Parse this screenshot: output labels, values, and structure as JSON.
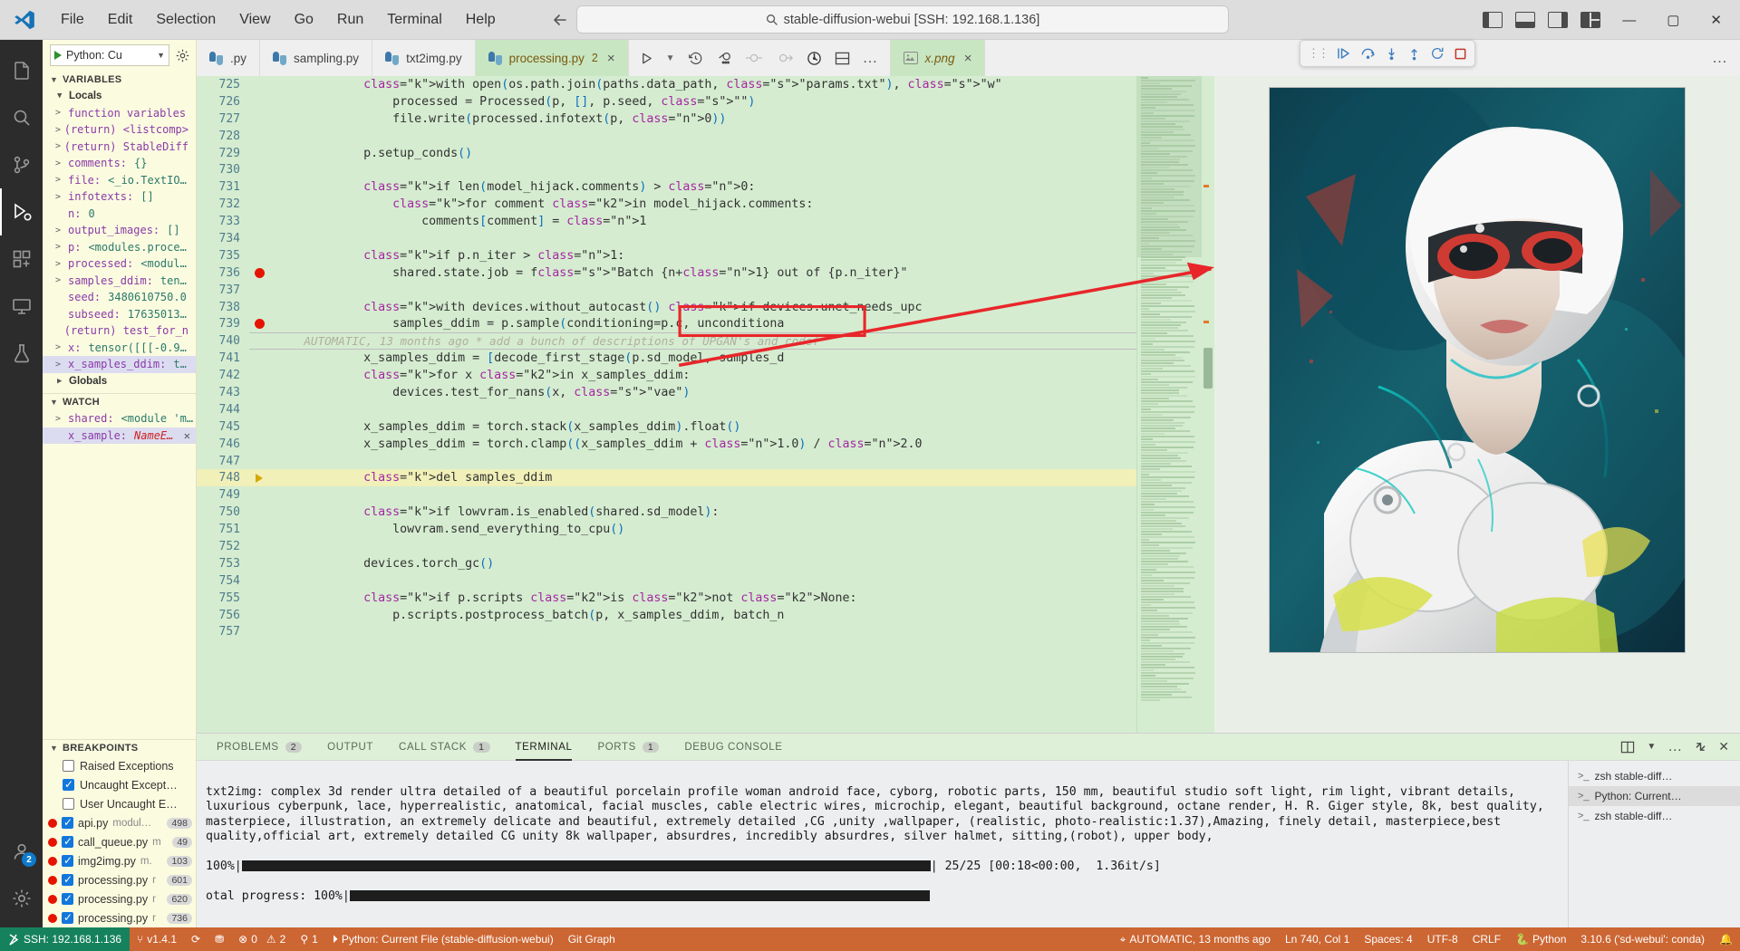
{
  "titlebar": {
    "menus": [
      "File",
      "Edit",
      "Selection",
      "View",
      "Go",
      "Run",
      "Terminal",
      "Help"
    ],
    "search_text": "stable-diffusion-webui [SSH: 192.168.1.136]",
    "search_icon": "search-icon",
    "back_icon": "arrow-left-icon",
    "forward_icon": "arrow-right-icon",
    "layout_icons": [
      "toggle-primary-sidebar-icon",
      "toggle-panel-icon",
      "toggle-secondary-sidebar-icon",
      "customize-layout-icon"
    ],
    "window_controls": [
      "minimize",
      "maximize",
      "close"
    ]
  },
  "activitybar": {
    "items": [
      {
        "name": "explorer",
        "icon": "files-icon"
      },
      {
        "name": "search",
        "icon": "search-icon"
      },
      {
        "name": "source-control",
        "icon": "source-control-icon"
      },
      {
        "name": "run-and-debug",
        "icon": "run-debug-icon",
        "active": true
      },
      {
        "name": "extensions",
        "icon": "extensions-icon"
      },
      {
        "name": "remote-explorer",
        "icon": "remote-explorer-icon"
      },
      {
        "name": "testing",
        "icon": "beaker-icon"
      }
    ],
    "accounts_badge": "2",
    "bottom": [
      {
        "name": "accounts",
        "icon": "account-icon"
      },
      {
        "name": "manage",
        "icon": "gear-icon"
      }
    ]
  },
  "sidebar": {
    "run_config": "Python: Cu",
    "run_play_icon": "play-icon",
    "run_gear_icon": "gear-icon",
    "sections": {
      "variables": {
        "title": "VARIABLES",
        "locals_label": "Locals",
        "globals_label": "Globals",
        "locals": [
          {
            "name": "function variables",
            "value": "",
            "expandable": true
          },
          {
            "name": "(return) <listcomp>",
            "value": "",
            "expandable": true
          },
          {
            "name": "(return) StableDiff",
            "value": "",
            "expandable": true
          },
          {
            "name": "comments",
            "value": "{}",
            "expandable": true
          },
          {
            "name": "file",
            "value": "<_io.TextIO…",
            "expandable": true
          },
          {
            "name": "infotexts",
            "value": "[]",
            "expandable": true
          },
          {
            "name": "n",
            "value": "0",
            "expandable": false
          },
          {
            "name": "output_images",
            "value": "[]",
            "expandable": true
          },
          {
            "name": "p",
            "value": "<modules.proce…",
            "expandable": true
          },
          {
            "name": "processed",
            "value": "<modul…",
            "expandable": true
          },
          {
            "name": "samples_ddim",
            "value": "ten…",
            "expandable": true
          },
          {
            "name": "seed",
            "value": "3480610750.0",
            "expandable": false
          },
          {
            "name": "subseed",
            "value": "17635013…",
            "expandable": false
          },
          {
            "name": "(return) test_for_n",
            "value": "",
            "expandable": false
          },
          {
            "name": "x",
            "value": "tensor([[[-0.9…",
            "expandable": true
          },
          {
            "name": "x_samples_ddim",
            "value": "t…",
            "expandable": true,
            "selected": true
          }
        ]
      },
      "watch": {
        "title": "WATCH",
        "items": [
          {
            "name": "shared",
            "value": "<module 'm…",
            "expandable": true,
            "error": false
          },
          {
            "name": "x_sample",
            "value": "NameE…",
            "expandable": false,
            "error": true,
            "selected": true
          }
        ]
      },
      "breakpoints": {
        "title": "BREAKPOINTS",
        "exceptions": [
          {
            "label": "Raised Exceptions",
            "checked": false
          },
          {
            "label": "Uncaught Except…",
            "checked": true
          },
          {
            "label": "User Uncaught E…",
            "checked": false
          }
        ],
        "files": [
          {
            "file": "api.py",
            "module": "modul…",
            "line": "498",
            "checked": true
          },
          {
            "file": "call_queue.py",
            "module": "m",
            "line": "49",
            "checked": true
          },
          {
            "file": "img2img.py",
            "module": "m.",
            "line": "103",
            "checked": true
          },
          {
            "file": "processing.py",
            "module": "r",
            "line": "601",
            "checked": true
          },
          {
            "file": "processing.py",
            "module": "r",
            "line": "620",
            "checked": true
          },
          {
            "file": "processing.py",
            "module": "r",
            "line": "736",
            "checked": true
          }
        ]
      }
    }
  },
  "editor": {
    "tabs": [
      {
        "label": ".py",
        "icon": "python-icon",
        "active": false,
        "truncated": true
      },
      {
        "label": "sampling.py",
        "icon": "python-icon",
        "active": false
      },
      {
        "label": "txt2img.py",
        "icon": "python-icon",
        "active": false
      },
      {
        "label": "processing.py",
        "icon": "python-icon",
        "active": true,
        "badge": "2",
        "close": "×"
      }
    ],
    "image_tab": {
      "label": "x.png",
      "icon": "image-icon",
      "close": "×"
    },
    "toolbar_icons": [
      "run-icon",
      "chevron-down-icon",
      "history-icon",
      "run-to-cursor-icon",
      "breakpoint-icon",
      "step-icon",
      "coverage-icon",
      "split-editor-icon",
      "more-actions-icon"
    ],
    "more_icon": "ellipsis-icon",
    "float_debug_icons": [
      "grip-handle",
      "continue-icon",
      "step-over-icon",
      "step-into-icon",
      "step-out-icon",
      "restart-icon",
      "stop-icon"
    ],
    "lines": [
      {
        "n": 725,
        "text": "with open(os.path.join(paths.data_path, \"params.txt\"), \"w\"",
        "indent": 3,
        "partial": true
      },
      {
        "n": 726,
        "text": "processed = Processed(p, [], p.seed, \"\")",
        "indent": 4
      },
      {
        "n": 727,
        "text": "file.write(processed.infotext(p, 0))",
        "indent": 4
      },
      {
        "n": 728,
        "text": "",
        "indent": 0
      },
      {
        "n": 729,
        "text": "p.setup_conds()",
        "indent": 3
      },
      {
        "n": 730,
        "text": "",
        "indent": 0
      },
      {
        "n": 731,
        "text": "if len(model_hijack.comments) > 0:",
        "indent": 3
      },
      {
        "n": 732,
        "text": "for comment in model_hijack.comments:",
        "indent": 4
      },
      {
        "n": 733,
        "text": "comments[comment] = 1",
        "indent": 5
      },
      {
        "n": 734,
        "text": "",
        "indent": 0
      },
      {
        "n": 735,
        "text": "if p.n_iter > 1:",
        "indent": 3
      },
      {
        "n": 736,
        "text": "shared.state.job = f\"Batch {n+1} out of {p.n_iter}\"",
        "indent": 4,
        "breakpoint": true
      },
      {
        "n": 737,
        "text": "",
        "indent": 0
      },
      {
        "n": 738,
        "text": "with devices.without_autocast() if devices.unet_needs_upc",
        "indent": 3
      },
      {
        "n": 739,
        "text": "samples_ddim = p.sample(conditioning=p.c, unconditiona",
        "indent": 4,
        "breakpoint": true
      },
      {
        "n": 740,
        "text": "AUTOMATIC, 13 months ago * add a bunch of descriptions of UPGAN's and codef",
        "indent": 0,
        "blame": true,
        "current": true
      },
      {
        "n": 741,
        "text": "x_samples_ddim = [decode_first_stage(p.sd_model, samples_d",
        "indent": 3
      },
      {
        "n": 742,
        "text": "for x in x_samples_ddim:",
        "indent": 3
      },
      {
        "n": 743,
        "text": "devices.test_for_nans(x, \"vae\")",
        "indent": 4
      },
      {
        "n": 744,
        "text": "",
        "indent": 0
      },
      {
        "n": 745,
        "text": "x_samples_ddim = torch.stack(x_samples_ddim).float()",
        "indent": 3
      },
      {
        "n": 746,
        "text": "x_samples_ddim = torch.clamp((x_samples_ddim + 1.0) / 2.0",
        "indent": 3
      },
      {
        "n": 747,
        "text": "",
        "indent": 0
      },
      {
        "n": 748,
        "text": "del samples_ddim",
        "indent": 3,
        "highlight": true,
        "execpointer": true
      },
      {
        "n": 749,
        "text": "",
        "indent": 0
      },
      {
        "n": 750,
        "text": "if lowvram.is_enabled(shared.sd_model):",
        "indent": 3
      },
      {
        "n": 751,
        "text": "lowvram.send_everything_to_cpu()",
        "indent": 4
      },
      {
        "n": 752,
        "text": "",
        "indent": 0
      },
      {
        "n": 753,
        "text": "devices.torch_gc()",
        "indent": 3
      },
      {
        "n": 754,
        "text": "",
        "indent": 0
      },
      {
        "n": 755,
        "text": "if p.scripts is not None:",
        "indent": 3
      },
      {
        "n": 756,
        "text": "p.scripts.postprocess_batch(p, x_samples_ddim, batch_n",
        "indent": 4
      },
      {
        "n": 757,
        "text": "",
        "indent": 0
      }
    ]
  },
  "panel": {
    "tabs": [
      {
        "label": "PROBLEMS",
        "count": "2",
        "active": false
      },
      {
        "label": "OUTPUT",
        "count": "",
        "active": false
      },
      {
        "label": "CALL STACK",
        "count": "1",
        "active": false
      },
      {
        "label": "TERMINAL",
        "count": "",
        "active": true
      },
      {
        "label": "PORTS",
        "count": "1",
        "active": false
      },
      {
        "label": "DEBUG CONSOLE",
        "count": "",
        "active": false
      }
    ],
    "actions": [
      "split-terminal-icon",
      "chevron-down-icon",
      "more-actions-icon",
      "maximize-panel-icon",
      "close-panel-icon"
    ],
    "terminal_text": "txt2img: complex 3d render ultra detailed of a beautiful porcelain profile woman android face, cyborg, robotic parts, 150 mm, beautiful studio soft light, rim light, vibrant details, luxurious cyberpunk, lace, hyperrealistic, anatomical, facial muscles, cable electric wires, microchip, elegant, beautiful background, octane render, H. R. Giger style, 8k, best quality, masterpiece, illustration, an extremely delicate and beautiful, extremely detailed ,CG ,unity ,wallpaper, (realistic, photo-realistic:1.37),Amazing, finely detail, masterpiece,best quality,official art, extremely detailed CG unity 8k wallpaper, absurdres, incredibly absurdres, silver halmet, sitting,(robot), upper body,",
    "progress_line": "100%|",
    "progress_stats": "| 25/25 [00:18<00:00,  1.36it/s]",
    "total_progress": "otal progress: 100%|",
    "terminal_list": [
      {
        "label": "zsh  stable-diff…",
        "active": false
      },
      {
        "label": "Python: Current…",
        "active": true
      },
      {
        "label": "zsh  stable-diff…",
        "active": false
      }
    ]
  },
  "statusbar": {
    "remote": "SSH: 192.168.1.136",
    "remote_icon": "remote-icon",
    "items": [
      {
        "icon": "git-branch-icon",
        "label": "v1.4.1"
      },
      {
        "icon": "sync-icon",
        "label": ""
      },
      {
        "icon": "graph-icon",
        "label": ""
      },
      {
        "icon": "error-icon",
        "label": "0"
      },
      {
        "icon": "warning-icon",
        "label": "2"
      },
      {
        "icon": "radio-tower-icon",
        "label": "1"
      },
      {
        "icon": "python-run-icon",
        "label": "Python: Current File (stable-diffusion-webui)"
      },
      {
        "icon": "",
        "label": "Git Graph"
      }
    ],
    "right_items": [
      {
        "icon": "git-blame-icon",
        "label": "AUTOMATIC, 13 months ago"
      },
      {
        "icon": "",
        "label": "Ln 740, Col 1"
      },
      {
        "icon": "",
        "label": "Spaces: 4"
      },
      {
        "icon": "",
        "label": "UTF-8"
      },
      {
        "icon": "",
        "label": "CRLF"
      },
      {
        "icon": "python-icon",
        "label": "Python"
      },
      {
        "icon": "",
        "label": "3.10.6 ('sd-webui': conda)"
      },
      {
        "icon": "bell-icon",
        "label": ""
      }
    ]
  },
  "colors": {
    "status_bg": "#cc6633",
    "remote_bg": "#16825d",
    "editor_bg": "#d5ecd0",
    "sidebar_bg": "#fbfbe0",
    "active_tab_bg": "#c8e6c2",
    "breakpoint_red": "#e51400",
    "annotation_red": "#e8262a"
  }
}
